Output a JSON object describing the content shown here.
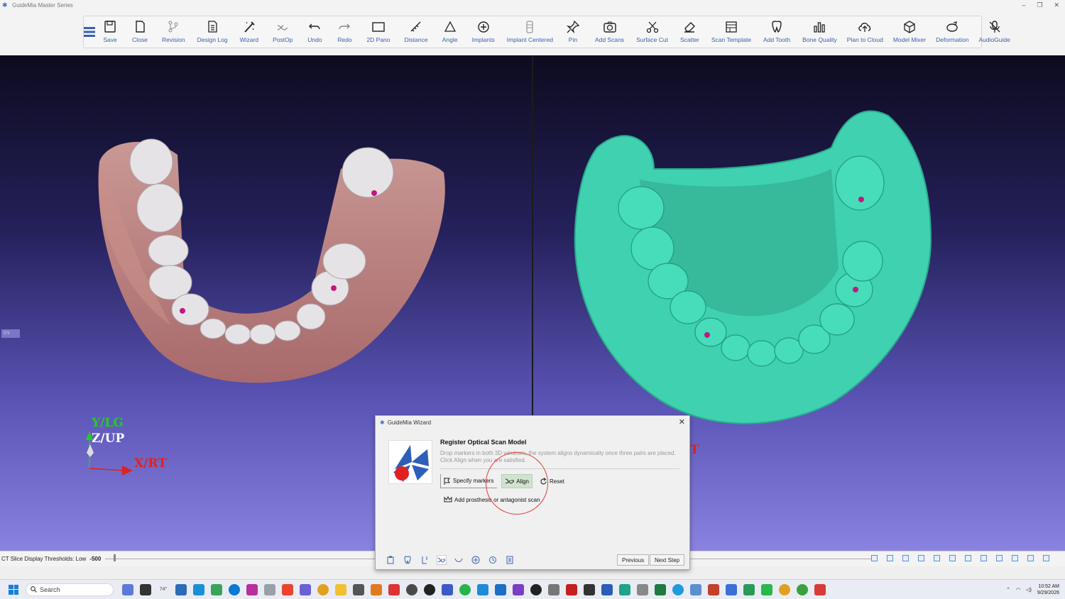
{
  "window": {
    "title": "GuideMia Master Series"
  },
  "toolbar": {
    "items": [
      {
        "label": "Save",
        "icon": "save-icon"
      },
      {
        "label": "Close",
        "icon": "close-file-icon"
      },
      {
        "label": "Revision",
        "icon": "revision-icon"
      },
      {
        "label": "Design Log",
        "icon": "design-log-icon"
      },
      {
        "label": "Wizard",
        "icon": "wizard-icon"
      },
      {
        "label": "PostOp",
        "icon": "postop-icon"
      },
      {
        "label": "Undo",
        "icon": "undo-icon"
      },
      {
        "label": "Redo",
        "icon": "redo-icon"
      },
      {
        "label": "2D Pano",
        "icon": "pano-icon"
      },
      {
        "label": "Distance",
        "icon": "distance-icon"
      },
      {
        "label": "Angle",
        "icon": "angle-icon"
      },
      {
        "label": "Implants",
        "icon": "implants-icon"
      },
      {
        "label": "Implant Centered",
        "icon": "implant-centered-icon"
      },
      {
        "label": "Pin",
        "icon": "pin-icon"
      },
      {
        "label": "Add Scans",
        "icon": "add-scans-icon"
      },
      {
        "label": "Surface Cut",
        "icon": "scissors-icon"
      },
      {
        "label": "Scatter",
        "icon": "eraser-icon"
      },
      {
        "label": "Scan Template",
        "icon": "scan-template-icon"
      },
      {
        "label": "Add Tooth",
        "icon": "tooth-icon"
      },
      {
        "label": "Bone Quality",
        "icon": "bone-quality-icon"
      },
      {
        "label": "Plan to Cloud",
        "icon": "cloud-upload-icon"
      },
      {
        "label": "Model Mixer",
        "icon": "cube-icon"
      },
      {
        "label": "Deformation",
        "icon": "deformation-icon"
      },
      {
        "label": "AudioGuide",
        "icon": "audio-guide-icon"
      }
    ]
  },
  "viewport_left": {
    "axis": {
      "y": "Y/LG",
      "z": "Z/UP",
      "x": "X/RT"
    },
    "lang": "EN"
  },
  "viewport_right": {
    "partial_label": "T"
  },
  "statusbar": {
    "threshold_label": "CT Slice Display Thresholds: Low",
    "threshold_value": "-500"
  },
  "wizard": {
    "title": "GuideMia Wizard",
    "heading": "Register Optical Scan Model",
    "description": "Drop markers in both 3D windows, the system aligns dynamically once three pairs are placed. Click Align when you are satisfied.",
    "specify_label": "Specify markers",
    "align_label": "Align",
    "reset_label": "Reset",
    "add_scan_label": "Add prosthesis or antagonist scan",
    "previous_label": "Previous",
    "next_label": "Next Step"
  },
  "taskbar": {
    "search_label": "Search",
    "weather": "74°",
    "time": "10:52 AM",
    "date": "9/29/2026"
  },
  "colors": {
    "accent": "#3b5fb0",
    "teal_model": "#3fd1b0",
    "marker": "#c2187f"
  }
}
